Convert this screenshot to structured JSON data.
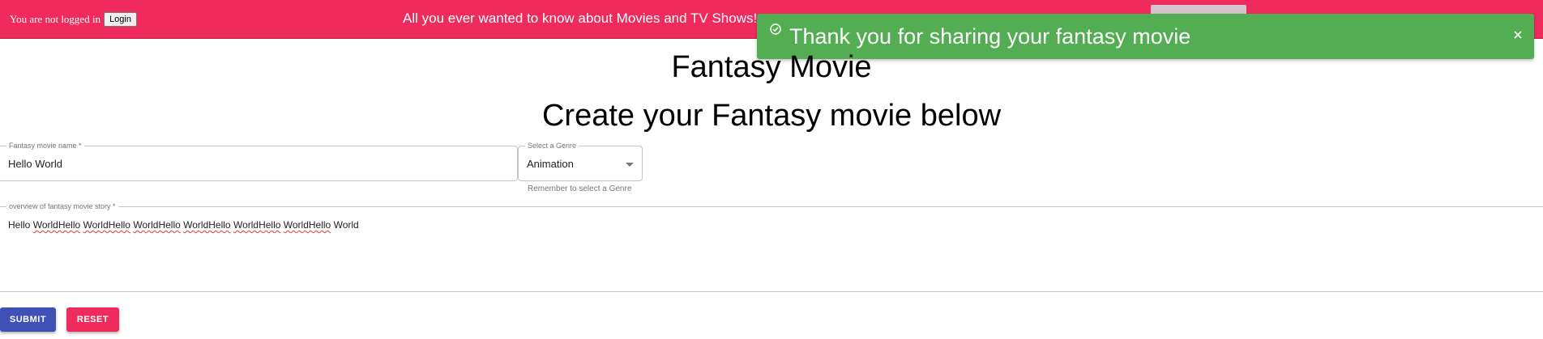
{
  "header": {
    "login_status": "You are not logged in",
    "login_button": "Login",
    "tagline": "All you ever wanted to know about Movies and TV Shows!"
  },
  "toast": {
    "message": "Thank you for sharing your fantasy movie",
    "icon": "check-circle-icon",
    "close_icon": "close-icon",
    "color": "#52ad53"
  },
  "page": {
    "title": "Fantasy Movie",
    "subtitle": "Create your Fantasy movie below"
  },
  "form": {
    "name_label": "Fantasy movie name *",
    "name_value": "Hello World",
    "genre_label": "Select a Genre",
    "genre_value": "Animation",
    "genre_helper": "Remember to select a Genre",
    "overview_label": "overview of fantasy movie story *",
    "overview_words": [
      "Hello",
      "WorldHello",
      "WorldHello",
      "WorldHello",
      "WorldHello",
      "WorldHello",
      "WorldHello",
      "World"
    ]
  },
  "actions": {
    "submit": "SUBMIT",
    "reset": "RESET"
  },
  "colors": {
    "brand": "#ef2a5d",
    "primary": "#3f51b5",
    "success": "#52ad53"
  }
}
